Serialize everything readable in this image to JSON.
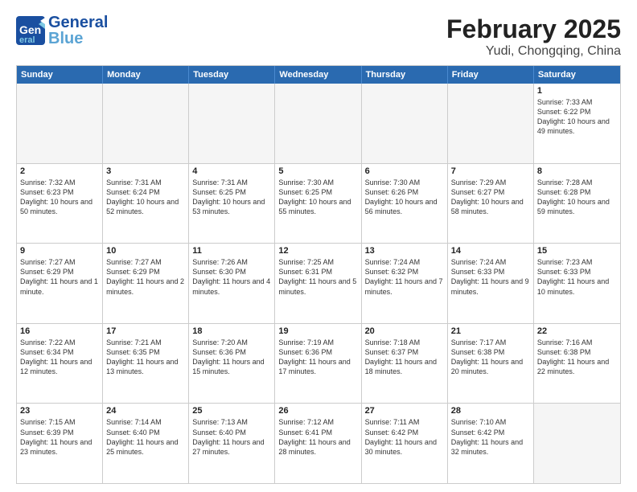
{
  "header": {
    "logo_line1": "General",
    "logo_line2": "Blue",
    "month": "February 2025",
    "location": "Yudi, Chongqing, China"
  },
  "weekdays": [
    "Sunday",
    "Monday",
    "Tuesday",
    "Wednesday",
    "Thursday",
    "Friday",
    "Saturday"
  ],
  "weeks": [
    [
      {
        "day": "",
        "info": ""
      },
      {
        "day": "",
        "info": ""
      },
      {
        "day": "",
        "info": ""
      },
      {
        "day": "",
        "info": ""
      },
      {
        "day": "",
        "info": ""
      },
      {
        "day": "",
        "info": ""
      },
      {
        "day": "1",
        "info": "Sunrise: 7:33 AM\nSunset: 6:22 PM\nDaylight: 10 hours\nand 49 minutes."
      }
    ],
    [
      {
        "day": "2",
        "info": "Sunrise: 7:32 AM\nSunset: 6:23 PM\nDaylight: 10 hours\nand 50 minutes."
      },
      {
        "day": "3",
        "info": "Sunrise: 7:31 AM\nSunset: 6:24 PM\nDaylight: 10 hours\nand 52 minutes."
      },
      {
        "day": "4",
        "info": "Sunrise: 7:31 AM\nSunset: 6:25 PM\nDaylight: 10 hours\nand 53 minutes."
      },
      {
        "day": "5",
        "info": "Sunrise: 7:30 AM\nSunset: 6:25 PM\nDaylight: 10 hours\nand 55 minutes."
      },
      {
        "day": "6",
        "info": "Sunrise: 7:30 AM\nSunset: 6:26 PM\nDaylight: 10 hours\nand 56 minutes."
      },
      {
        "day": "7",
        "info": "Sunrise: 7:29 AM\nSunset: 6:27 PM\nDaylight: 10 hours\nand 58 minutes."
      },
      {
        "day": "8",
        "info": "Sunrise: 7:28 AM\nSunset: 6:28 PM\nDaylight: 10 hours\nand 59 minutes."
      }
    ],
    [
      {
        "day": "9",
        "info": "Sunrise: 7:27 AM\nSunset: 6:29 PM\nDaylight: 11 hours\nand 1 minute."
      },
      {
        "day": "10",
        "info": "Sunrise: 7:27 AM\nSunset: 6:29 PM\nDaylight: 11 hours\nand 2 minutes."
      },
      {
        "day": "11",
        "info": "Sunrise: 7:26 AM\nSunset: 6:30 PM\nDaylight: 11 hours\nand 4 minutes."
      },
      {
        "day": "12",
        "info": "Sunrise: 7:25 AM\nSunset: 6:31 PM\nDaylight: 11 hours\nand 5 minutes."
      },
      {
        "day": "13",
        "info": "Sunrise: 7:24 AM\nSunset: 6:32 PM\nDaylight: 11 hours\nand 7 minutes."
      },
      {
        "day": "14",
        "info": "Sunrise: 7:24 AM\nSunset: 6:33 PM\nDaylight: 11 hours\nand 9 minutes."
      },
      {
        "day": "15",
        "info": "Sunrise: 7:23 AM\nSunset: 6:33 PM\nDaylight: 11 hours\nand 10 minutes."
      }
    ],
    [
      {
        "day": "16",
        "info": "Sunrise: 7:22 AM\nSunset: 6:34 PM\nDaylight: 11 hours\nand 12 minutes."
      },
      {
        "day": "17",
        "info": "Sunrise: 7:21 AM\nSunset: 6:35 PM\nDaylight: 11 hours\nand 13 minutes."
      },
      {
        "day": "18",
        "info": "Sunrise: 7:20 AM\nSunset: 6:36 PM\nDaylight: 11 hours\nand 15 minutes."
      },
      {
        "day": "19",
        "info": "Sunrise: 7:19 AM\nSunset: 6:36 PM\nDaylight: 11 hours\nand 17 minutes."
      },
      {
        "day": "20",
        "info": "Sunrise: 7:18 AM\nSunset: 6:37 PM\nDaylight: 11 hours\nand 18 minutes."
      },
      {
        "day": "21",
        "info": "Sunrise: 7:17 AM\nSunset: 6:38 PM\nDaylight: 11 hours\nand 20 minutes."
      },
      {
        "day": "22",
        "info": "Sunrise: 7:16 AM\nSunset: 6:38 PM\nDaylight: 11 hours\nand 22 minutes."
      }
    ],
    [
      {
        "day": "23",
        "info": "Sunrise: 7:15 AM\nSunset: 6:39 PM\nDaylight: 11 hours\nand 23 minutes."
      },
      {
        "day": "24",
        "info": "Sunrise: 7:14 AM\nSunset: 6:40 PM\nDaylight: 11 hours\nand 25 minutes."
      },
      {
        "day": "25",
        "info": "Sunrise: 7:13 AM\nSunset: 6:40 PM\nDaylight: 11 hours\nand 27 minutes."
      },
      {
        "day": "26",
        "info": "Sunrise: 7:12 AM\nSunset: 6:41 PM\nDaylight: 11 hours\nand 28 minutes."
      },
      {
        "day": "27",
        "info": "Sunrise: 7:11 AM\nSunset: 6:42 PM\nDaylight: 11 hours\nand 30 minutes."
      },
      {
        "day": "28",
        "info": "Sunrise: 7:10 AM\nSunset: 6:42 PM\nDaylight: 11 hours\nand 32 minutes."
      },
      {
        "day": "",
        "info": ""
      }
    ]
  ]
}
